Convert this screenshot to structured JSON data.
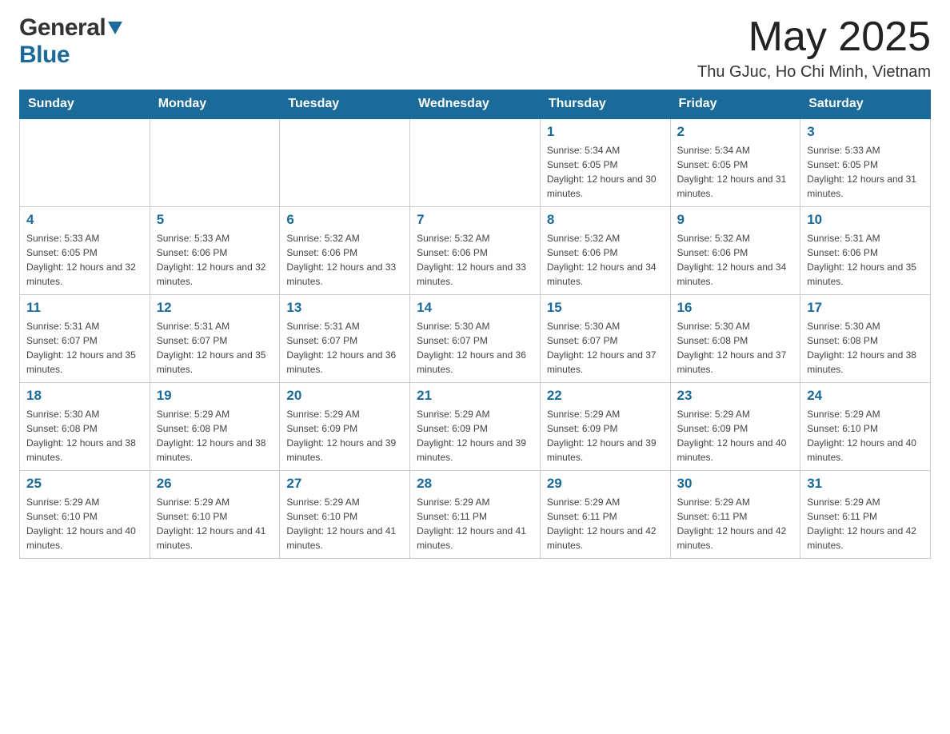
{
  "header": {
    "logo_general": "General",
    "logo_blue": "Blue",
    "month": "May 2025",
    "location": "Thu GJuc, Ho Chi Minh, Vietnam"
  },
  "days_of_week": [
    "Sunday",
    "Monday",
    "Tuesday",
    "Wednesday",
    "Thursday",
    "Friday",
    "Saturday"
  ],
  "weeks": [
    [
      {
        "day": "",
        "sunrise": "",
        "sunset": "",
        "daylight": ""
      },
      {
        "day": "",
        "sunrise": "",
        "sunset": "",
        "daylight": ""
      },
      {
        "day": "",
        "sunrise": "",
        "sunset": "",
        "daylight": ""
      },
      {
        "day": "",
        "sunrise": "",
        "sunset": "",
        "daylight": ""
      },
      {
        "day": "1",
        "sunrise": "Sunrise: 5:34 AM",
        "sunset": "Sunset: 6:05 PM",
        "daylight": "Daylight: 12 hours and 30 minutes."
      },
      {
        "day": "2",
        "sunrise": "Sunrise: 5:34 AM",
        "sunset": "Sunset: 6:05 PM",
        "daylight": "Daylight: 12 hours and 31 minutes."
      },
      {
        "day": "3",
        "sunrise": "Sunrise: 5:33 AM",
        "sunset": "Sunset: 6:05 PM",
        "daylight": "Daylight: 12 hours and 31 minutes."
      }
    ],
    [
      {
        "day": "4",
        "sunrise": "Sunrise: 5:33 AM",
        "sunset": "Sunset: 6:05 PM",
        "daylight": "Daylight: 12 hours and 32 minutes."
      },
      {
        "day": "5",
        "sunrise": "Sunrise: 5:33 AM",
        "sunset": "Sunset: 6:06 PM",
        "daylight": "Daylight: 12 hours and 32 minutes."
      },
      {
        "day": "6",
        "sunrise": "Sunrise: 5:32 AM",
        "sunset": "Sunset: 6:06 PM",
        "daylight": "Daylight: 12 hours and 33 minutes."
      },
      {
        "day": "7",
        "sunrise": "Sunrise: 5:32 AM",
        "sunset": "Sunset: 6:06 PM",
        "daylight": "Daylight: 12 hours and 33 minutes."
      },
      {
        "day": "8",
        "sunrise": "Sunrise: 5:32 AM",
        "sunset": "Sunset: 6:06 PM",
        "daylight": "Daylight: 12 hours and 34 minutes."
      },
      {
        "day": "9",
        "sunrise": "Sunrise: 5:32 AM",
        "sunset": "Sunset: 6:06 PM",
        "daylight": "Daylight: 12 hours and 34 minutes."
      },
      {
        "day": "10",
        "sunrise": "Sunrise: 5:31 AM",
        "sunset": "Sunset: 6:06 PM",
        "daylight": "Daylight: 12 hours and 35 minutes."
      }
    ],
    [
      {
        "day": "11",
        "sunrise": "Sunrise: 5:31 AM",
        "sunset": "Sunset: 6:07 PM",
        "daylight": "Daylight: 12 hours and 35 minutes."
      },
      {
        "day": "12",
        "sunrise": "Sunrise: 5:31 AM",
        "sunset": "Sunset: 6:07 PM",
        "daylight": "Daylight: 12 hours and 35 minutes."
      },
      {
        "day": "13",
        "sunrise": "Sunrise: 5:31 AM",
        "sunset": "Sunset: 6:07 PM",
        "daylight": "Daylight: 12 hours and 36 minutes."
      },
      {
        "day": "14",
        "sunrise": "Sunrise: 5:30 AM",
        "sunset": "Sunset: 6:07 PM",
        "daylight": "Daylight: 12 hours and 36 minutes."
      },
      {
        "day": "15",
        "sunrise": "Sunrise: 5:30 AM",
        "sunset": "Sunset: 6:07 PM",
        "daylight": "Daylight: 12 hours and 37 minutes."
      },
      {
        "day": "16",
        "sunrise": "Sunrise: 5:30 AM",
        "sunset": "Sunset: 6:08 PM",
        "daylight": "Daylight: 12 hours and 37 minutes."
      },
      {
        "day": "17",
        "sunrise": "Sunrise: 5:30 AM",
        "sunset": "Sunset: 6:08 PM",
        "daylight": "Daylight: 12 hours and 38 minutes."
      }
    ],
    [
      {
        "day": "18",
        "sunrise": "Sunrise: 5:30 AM",
        "sunset": "Sunset: 6:08 PM",
        "daylight": "Daylight: 12 hours and 38 minutes."
      },
      {
        "day": "19",
        "sunrise": "Sunrise: 5:29 AM",
        "sunset": "Sunset: 6:08 PM",
        "daylight": "Daylight: 12 hours and 38 minutes."
      },
      {
        "day": "20",
        "sunrise": "Sunrise: 5:29 AM",
        "sunset": "Sunset: 6:09 PM",
        "daylight": "Daylight: 12 hours and 39 minutes."
      },
      {
        "day": "21",
        "sunrise": "Sunrise: 5:29 AM",
        "sunset": "Sunset: 6:09 PM",
        "daylight": "Daylight: 12 hours and 39 minutes."
      },
      {
        "day": "22",
        "sunrise": "Sunrise: 5:29 AM",
        "sunset": "Sunset: 6:09 PM",
        "daylight": "Daylight: 12 hours and 39 minutes."
      },
      {
        "day": "23",
        "sunrise": "Sunrise: 5:29 AM",
        "sunset": "Sunset: 6:09 PM",
        "daylight": "Daylight: 12 hours and 40 minutes."
      },
      {
        "day": "24",
        "sunrise": "Sunrise: 5:29 AM",
        "sunset": "Sunset: 6:10 PM",
        "daylight": "Daylight: 12 hours and 40 minutes."
      }
    ],
    [
      {
        "day": "25",
        "sunrise": "Sunrise: 5:29 AM",
        "sunset": "Sunset: 6:10 PM",
        "daylight": "Daylight: 12 hours and 40 minutes."
      },
      {
        "day": "26",
        "sunrise": "Sunrise: 5:29 AM",
        "sunset": "Sunset: 6:10 PM",
        "daylight": "Daylight: 12 hours and 41 minutes."
      },
      {
        "day": "27",
        "sunrise": "Sunrise: 5:29 AM",
        "sunset": "Sunset: 6:10 PM",
        "daylight": "Daylight: 12 hours and 41 minutes."
      },
      {
        "day": "28",
        "sunrise": "Sunrise: 5:29 AM",
        "sunset": "Sunset: 6:11 PM",
        "daylight": "Daylight: 12 hours and 41 minutes."
      },
      {
        "day": "29",
        "sunrise": "Sunrise: 5:29 AM",
        "sunset": "Sunset: 6:11 PM",
        "daylight": "Daylight: 12 hours and 42 minutes."
      },
      {
        "day": "30",
        "sunrise": "Sunrise: 5:29 AM",
        "sunset": "Sunset: 6:11 PM",
        "daylight": "Daylight: 12 hours and 42 minutes."
      },
      {
        "day": "31",
        "sunrise": "Sunrise: 5:29 AM",
        "sunset": "Sunset: 6:11 PM",
        "daylight": "Daylight: 12 hours and 42 minutes."
      }
    ]
  ]
}
